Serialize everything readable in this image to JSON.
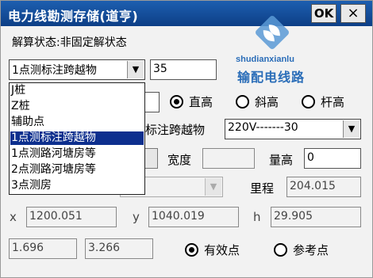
{
  "window": {
    "title": "电力线勘测存储(道亨)",
    "ok_label": "OK",
    "close_label": "×"
  },
  "status": {
    "text": "解算状态:非固定解状态"
  },
  "watermark": {
    "latin": "shudianxianlu",
    "chinese": "输配电线路"
  },
  "point_type": {
    "selected": "1点测标注跨越物",
    "number": "35",
    "options": [
      "J桩",
      "Z桩",
      "辅助点",
      "1点测标注跨越物",
      "1点测路河塘房等",
      "2点测路河塘房等",
      "3点测房"
    ],
    "selected_index": 3
  },
  "height_mode": {
    "options": [
      {
        "label": "直高",
        "checked": true
      },
      {
        "label": "斜高",
        "checked": false
      },
      {
        "label": "杆高",
        "checked": false
      }
    ]
  },
  "crossing": {
    "label": "标注跨越物",
    "value": "220V-------30"
  },
  "width": {
    "label": "宽度",
    "value": ""
  },
  "measure_height": {
    "label": "量高",
    "value": "0"
  },
  "mileage": {
    "label": "里程",
    "value": "204.015"
  },
  "coords": {
    "x_label": "x",
    "x_value": "1200.051",
    "y_label": "y",
    "y_value": "1040.019",
    "h_label": "h",
    "h_value": "29.905"
  },
  "bottom": {
    "value1": "1.696",
    "value2": "3.266",
    "point_mode": [
      {
        "label": "有效点",
        "checked": true
      },
      {
        "label": "参考点",
        "checked": false
      }
    ]
  }
}
